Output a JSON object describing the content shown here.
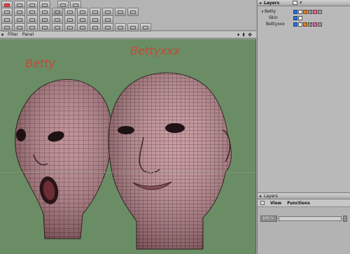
{
  "viewport": {
    "menus": [
      "Filter",
      "Panel"
    ],
    "nav_controls": [
      "▾",
      "⬍",
      "✥"
    ],
    "annotations": [
      "Betty",
      "Bettyxxx"
    ],
    "annotation_color": "#c04a3a",
    "background_color": "#6b8d65",
    "model_color": "#b67f86"
  },
  "layers_panel": {
    "title": "Layers",
    "tree": [
      {
        "name": "Betty",
        "level": 0,
        "expanded": true
      },
      {
        "name": "Skin",
        "level": 1
      },
      {
        "name": "Bettyxxx",
        "level": 1
      }
    ]
  },
  "lower_panel": {
    "title": "Layers",
    "menus": [
      "View",
      "Functions"
    ],
    "slider_value": "100 %",
    "slider_fill": 0.0
  },
  "icons": {
    "toolbar": [
      "select-icon",
      "move-icon",
      "rotate-icon",
      "scale-icon",
      "brush-icon",
      "grid-icon"
    ],
    "layer_visibility": "eye-icon"
  }
}
